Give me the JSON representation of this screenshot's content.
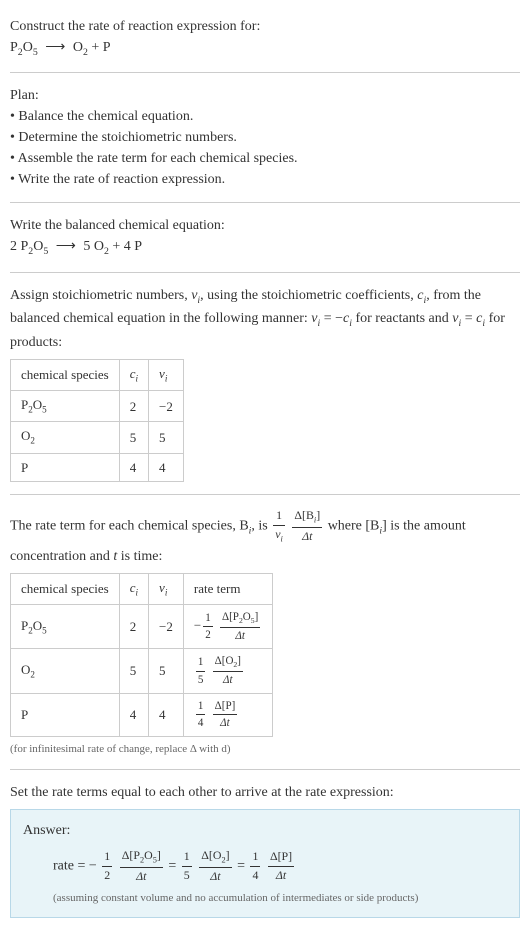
{
  "header": {
    "title": "Construct the rate of reaction expression for:",
    "equation_lhs": "P",
    "equation_lhs_sub1": "2",
    "equation_lhs_mid": "O",
    "equation_lhs_sub2": "5",
    "arrow": "⟶",
    "equation_rhs1": "O",
    "equation_rhs1_sub": "2",
    "equation_plus": " + P"
  },
  "plan": {
    "label": "Plan:",
    "items": [
      "Balance the chemical equation.",
      "Determine the stoichiometric numbers.",
      "Assemble the rate term for each chemical species.",
      "Write the rate of reaction expression."
    ]
  },
  "balanced": {
    "label": "Write the balanced chemical equation:",
    "eq_c1": "2 P",
    "eq_sub1": "2",
    "eq_mid": "O",
    "eq_sub2": "5",
    "arrow": "⟶",
    "eq_c2": "5 O",
    "eq_sub3": "2",
    "eq_c3": " + 4 P"
  },
  "stoich": {
    "desc_part1": "Assign stoichiometric numbers, ",
    "desc_nu": "ν",
    "desc_sub_i": "i",
    "desc_part2": ", using the stoichiometric coefficients, ",
    "desc_c": "c",
    "desc_part3": ", from the balanced chemical equation in the following manner: ",
    "desc_eq1": " = −",
    "desc_part4": " for reactants and ",
    "desc_eq2": " = ",
    "desc_part5": " for products:",
    "headers": {
      "species": "chemical species",
      "ci": "c",
      "ci_sub": "i",
      "nui": "ν",
      "nui_sub": "i"
    },
    "rows": [
      {
        "species_main": "P",
        "species_sub1": "2",
        "species_mid": "O",
        "species_sub2": "5",
        "ci": "2",
        "nui": "−2"
      },
      {
        "species_main": "O",
        "species_sub1": "2",
        "species_mid": "",
        "species_sub2": "",
        "ci": "5",
        "nui": "5"
      },
      {
        "species_main": "P",
        "species_sub1": "",
        "species_mid": "",
        "species_sub2": "",
        "ci": "4",
        "nui": "4"
      }
    ]
  },
  "rateterm": {
    "desc_p1": "The rate term for each chemical species, B",
    "desc_sub_i": "i",
    "desc_p2": ", is ",
    "frac1_num": "1",
    "frac1_den_nu": "ν",
    "frac1_den_sub": "i",
    "frac2_num_delta": "Δ[B",
    "frac2_num_sub": "i",
    "frac2_num_close": "]",
    "frac2_den": "Δt",
    "desc_p3": " where [B",
    "desc_p4": "] is the amount concentration and ",
    "desc_t": "t",
    "desc_p5": " is time:",
    "headers": {
      "species": "chemical species",
      "ci": "c",
      "ci_sub": "i",
      "nui": "ν",
      "nui_sub": "i",
      "rate": "rate term"
    },
    "rows": [
      {
        "species_main": "P",
        "species_sub1": "2",
        "species_mid": "O",
        "species_sub2": "5",
        "ci": "2",
        "nui": "−2",
        "neg": "−",
        "f1num": "1",
        "f1den": "2",
        "f2num": "Δ[P",
        "f2num_sub1": "2",
        "f2num_mid": "O",
        "f2num_sub2": "5",
        "f2num_close": "]",
        "f2den": "Δt"
      },
      {
        "species_main": "O",
        "species_sub1": "2",
        "species_mid": "",
        "species_sub2": "",
        "ci": "5",
        "nui": "5",
        "neg": "",
        "f1num": "1",
        "f1den": "5",
        "f2num": "Δ[O",
        "f2num_sub1": "2",
        "f2num_mid": "",
        "f2num_sub2": "",
        "f2num_close": "]",
        "f2den": "Δt"
      },
      {
        "species_main": "P",
        "species_sub1": "",
        "species_mid": "",
        "species_sub2": "",
        "ci": "4",
        "nui": "4",
        "neg": "",
        "f1num": "1",
        "f1den": "4",
        "f2num": "Δ[P]",
        "f2num_sub1": "",
        "f2num_mid": "",
        "f2num_sub2": "",
        "f2num_close": "",
        "f2den": "Δt"
      }
    ],
    "note": "(for infinitesimal rate of change, replace Δ with d)"
  },
  "final": {
    "label": "Set the rate terms equal to each other to arrive at the rate expression:"
  },
  "answer": {
    "label": "Answer:",
    "rate_word": "rate = −",
    "t1_f1num": "1",
    "t1_f1den": "2",
    "t1_f2num": "Δ[P",
    "t1_f2sub1": "2",
    "t1_f2mid": "O",
    "t1_f2sub2": "5",
    "t1_f2close": "]",
    "t1_f2den": "Δt",
    "eq": " = ",
    "t2_f1num": "1",
    "t2_f1den": "5",
    "t2_f2num": "Δ[O",
    "t2_f2sub1": "2",
    "t2_f2close": "]",
    "t2_f2den": "Δt",
    "t3_f1num": "1",
    "t3_f1den": "4",
    "t3_f2num": "Δ[P]",
    "t3_f2den": "Δt",
    "note": "(assuming constant volume and no accumulation of intermediates or side products)"
  }
}
